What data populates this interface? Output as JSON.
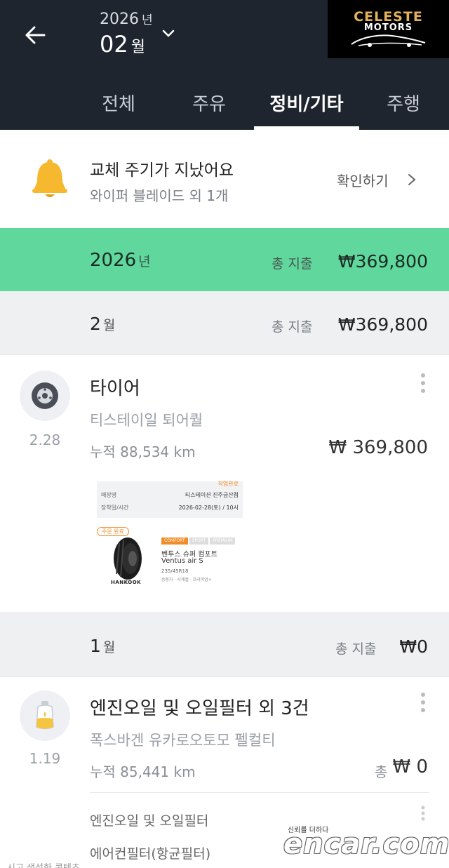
{
  "header": {
    "year_num": "2026",
    "year_unit": "년",
    "month_num": "02",
    "month_unit": "월",
    "logo_line1": "CELESTE",
    "logo_line2": "MOTORS",
    "tabs": [
      {
        "label": "전체",
        "active": false
      },
      {
        "label": "주유",
        "active": false
      },
      {
        "label": "정비/기타",
        "active": true
      },
      {
        "label": "주행",
        "active": false
      }
    ]
  },
  "notice": {
    "title": "교체 주기가 지났어요",
    "subtitle": "와이퍼 블레이드 외 1개",
    "action_label": "확인하기"
  },
  "year_summary": {
    "year": "2026",
    "unit": "년",
    "total_label": "총 지출",
    "total_value": "₩369,800"
  },
  "months": [
    {
      "month": "2",
      "unit": "월",
      "total_label": "총 지출",
      "total_value": "₩369,800"
    },
    {
      "month": "1",
      "unit": "월",
      "total_label": "총 지출",
      "total_value": "₩0"
    }
  ],
  "records": [
    {
      "icon": "tire-icon",
      "date": "2.28",
      "title": "타이어",
      "shop": "티스테이일 퇴어퀄",
      "odometer": "누적 88,534 km",
      "amount": "₩ 369,800",
      "receipt": {
        "row0_value": "작업완료",
        "rows": [
          {
            "key": "매장명",
            "value": "티스테이션 진주금산점"
          },
          {
            "key": "장착일/시간",
            "value": "2026-02-28(토) / 10시"
          }
        ],
        "badge": "주문 완료",
        "chips": [
          "COMFORT",
          "SPORT",
          "PREMIUM"
        ],
        "product_name": "벤투스 슈퍼 컴포트",
        "model": "Ventus air S",
        "size": "235/45R18",
        "meta": "승용차 · 사계절 · 프리미엄+",
        "brand": "HANKOOK"
      }
    },
    {
      "icon": "oil-icon",
      "date": "1.19",
      "title": "엔진오일 및 오일필터 외 3건",
      "shop": "폭스바겐 유카로오토모 펠컬티",
      "odometer": "누적 85,441 km",
      "amount_label": "총",
      "amount": "₩ 0",
      "items": [
        "엔진오일 및 오일필터",
        "에어컨필터(항균필터)"
      ]
    }
  ],
  "watermark": {
    "tagline": "신뢰를 더하다",
    "brand": "encar.com"
  },
  "footer_cutoff": "시고 생성한 콘텐츠",
  "colors": {
    "header_bg": "#1f252e",
    "year_bar_bg": "#5fd79d",
    "bell_yellow": "#f5b82e"
  }
}
